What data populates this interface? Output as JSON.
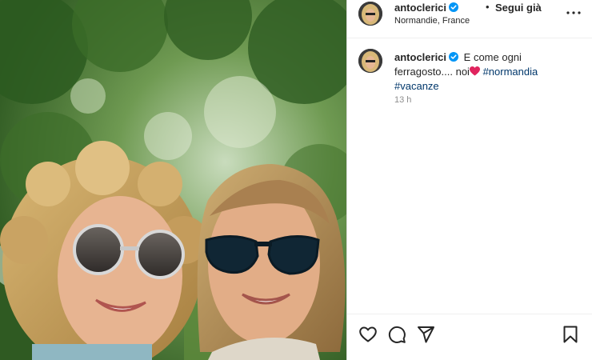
{
  "header": {
    "username": "antoclerici",
    "separator": "•",
    "follow_label": "Segui già",
    "location": "Normandie, France"
  },
  "caption": {
    "username": "antoclerici",
    "text": "E come ogni ferragosto.... noi",
    "hashtags": [
      "#normandia",
      "#vacanze"
    ],
    "time": "13 h"
  },
  "icons": {
    "verified": "verified-badge-icon",
    "more": "more-options-icon",
    "like": "heart-icon",
    "comment": "comment-icon",
    "share": "paper-plane-icon",
    "save": "bookmark-icon"
  },
  "colors": {
    "verified": "#0095f6",
    "hashtag": "#00376b",
    "emoji_heart": "#e0245e",
    "muted": "#8e8e8e"
  }
}
